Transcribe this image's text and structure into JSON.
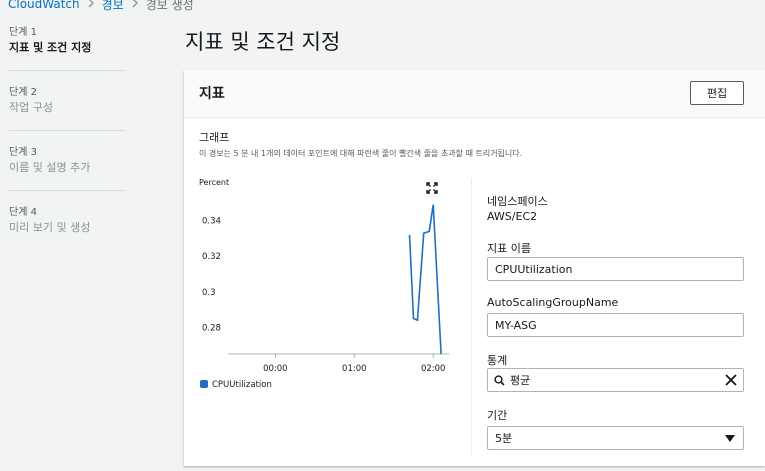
{
  "breadcrumb": {
    "root": "CloudWatch",
    "middle": "경보",
    "current": "경보 생성"
  },
  "steps": [
    {
      "num": "단계 1",
      "title": "지표 및 조건 지정"
    },
    {
      "num": "단계 2",
      "title": "작업 구성"
    },
    {
      "num": "단계 3",
      "title": "이름 및 설명 추가"
    },
    {
      "num": "단계 4",
      "title": "미리 보기 및 생성"
    }
  ],
  "page_title": "지표 및 조건 지정",
  "panel": {
    "title": "지표",
    "edit_label": "편집",
    "graph_title": "그래프",
    "graph_desc": "이 경보는 5 분 내 1개의 데이터 포인트에 대해 파란색 줄이 빨간색 줄을 초과할 때 트리거됩니다."
  },
  "form": {
    "namespace_label": "네임스페이스",
    "namespace_value": "AWS/EC2",
    "metric_name_label": "지표 이름",
    "metric_name_value": "CPUUtilization",
    "asg_label": "AutoScalingGroupName",
    "asg_value": "MY-ASG",
    "stat_label": "통계",
    "stat_value": "평균",
    "period_label": "기간",
    "period_value": "5분"
  },
  "colors": {
    "series": "#1f6fbf",
    "link": "#0073bb"
  },
  "icons": [
    "chevron-right-icon",
    "expand-icon",
    "search-icon",
    "clear-icon",
    "caret-down-icon"
  ],
  "chart_data": {
    "type": "line",
    "ylabel": "Percent",
    "yticks": [
      0.28,
      0.3,
      0.32,
      0.34
    ],
    "ylim": [
      0.265,
      0.355
    ],
    "xticks": [
      "00:00",
      "01:00",
      "02:00"
    ],
    "xlim": [
      -0.6,
      2.2
    ],
    "series": [
      {
        "name": "CPUUtilization",
        "x": [
          1.7,
          1.75,
          1.8,
          1.88,
          1.95,
          2.0,
          2.1
        ],
        "y": [
          0.332,
          0.285,
          0.284,
          0.333,
          0.334,
          0.349,
          0.265
        ]
      }
    ]
  }
}
